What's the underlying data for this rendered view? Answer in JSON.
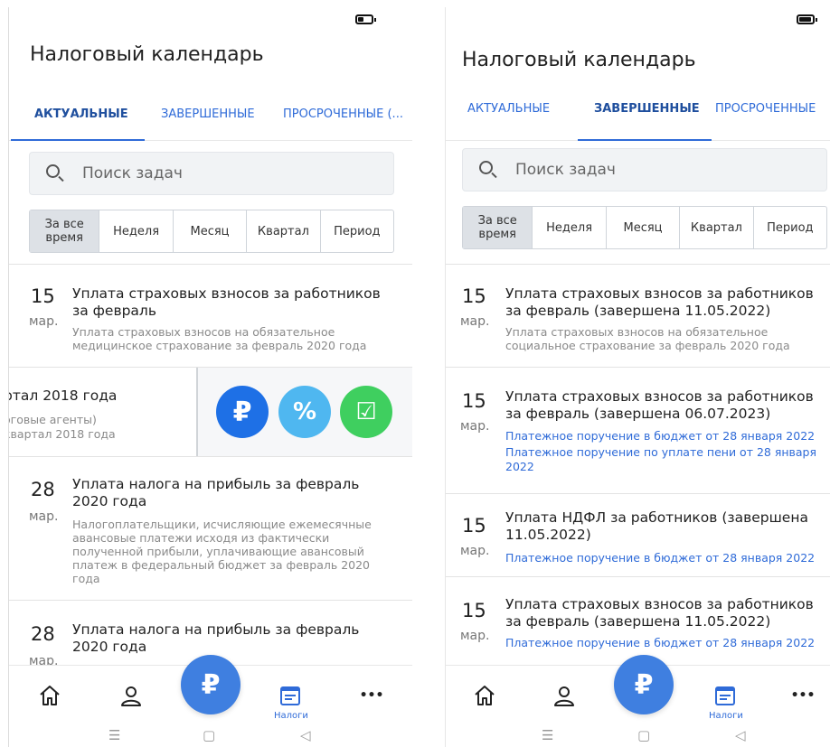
{
  "colors": {
    "accent": "#2f6bd8",
    "fab": "#3f7fe0",
    "pay": "#1e70e6",
    "percent": "#4fb7f0",
    "done": "#3fcf5f"
  },
  "screen1": {
    "title": "Налоговый календарь",
    "tabs": [
      "АКТУАЛЬНЫЕ",
      "ЗАВЕРШЕННЫЕ",
      "ПРОСРОЧЕННЫЕ (..."
    ],
    "active_tab": 0,
    "search_placeholder": "Поиск задач",
    "periods": [
      "За все время",
      "Неделя",
      "Месяц",
      "Квартал",
      "Период"
    ],
    "tasks": [
      {
        "day": "15",
        "month": "мар.",
        "title": "Уплата страховых взносов за работников за февраль",
        "desc": "Уплата страховых взносов на обязательное медицинское страхование за февраль 2020 года"
      },
      {
        "day": "28",
        "month": "мар.",
        "title": "Уплата налога на прибыль за февраль 2020 года",
        "desc": "Налогоплательщики, исчисляющие ежемесячные авансовые платежи исходя из фактически полученной прибыли, уплачивающие авансовый платеж в федеральный бюджет за февраль 2020 года"
      },
      {
        "day": "28",
        "month": "мар.",
        "title": "Уплата налога на прибыль за февраль 2020 года"
      }
    ],
    "swiped_task": {
      "title": "ртал 2018 года",
      "line1": "оговые агенты)",
      "line2": "квартал 2018 года"
    },
    "swipe_actions": [
      {
        "icon": "ruble-icon",
        "glyph": "₽"
      },
      {
        "icon": "percent-icon",
        "glyph": "%"
      },
      {
        "icon": "checkbox-icon",
        "glyph": "☑"
      }
    ]
  },
  "screen2": {
    "title": "Налоговый календарь",
    "tabs": [
      "АКТУАЛЬНЫЕ",
      "ЗАВЕРШЕННЫЕ",
      "ПРОСРОЧЕННЫЕ"
    ],
    "active_tab": 1,
    "search_placeholder": "Поиск задач",
    "periods": [
      "За все время",
      "Неделя",
      "Месяц",
      "Квартал",
      "Период"
    ],
    "tasks": [
      {
        "day": "15",
        "month": "мар.",
        "title": "Уплата страховых взносов за работников за февраль (завершена 11.05.2022)",
        "desc": "Уплата страховых взносов на обязательное социальное страхование за февраль 2020 года"
      },
      {
        "day": "15",
        "month": "мар.",
        "title": "Уплата страховых взносов за работников за февраль (завершена 06.07.2023)",
        "links": [
          "Платежное поручение в бюджет от 28 января 2022",
          "Платежное поручение по уплате пени от 28 января 2022"
        ]
      },
      {
        "day": "15",
        "month": "мар.",
        "title": "Уплата НДФЛ за работников (завершена 11.05.2022)",
        "links": [
          "Платежное поручение в бюджет от 28 января 2022"
        ]
      },
      {
        "day": "15",
        "month": "мар.",
        "title": "Уплата страховых взносов за работников за февраль (завершена 11.05.2022)",
        "links": [
          "Платежное поручение в бюджет от 28 января 2022"
        ]
      }
    ]
  },
  "bottom_nav": {
    "items": [
      {
        "icon": "home-icon"
      },
      {
        "icon": "profile-icon"
      },
      {
        "icon": "ruble-fab-icon",
        "glyph": "₽"
      },
      {
        "icon": "calendar-icon",
        "label": "Налоги"
      },
      {
        "icon": "more-icon",
        "glyph": "•••"
      }
    ]
  },
  "system_nav": {
    "menu": "☰",
    "home": "▢",
    "back": "◁"
  }
}
